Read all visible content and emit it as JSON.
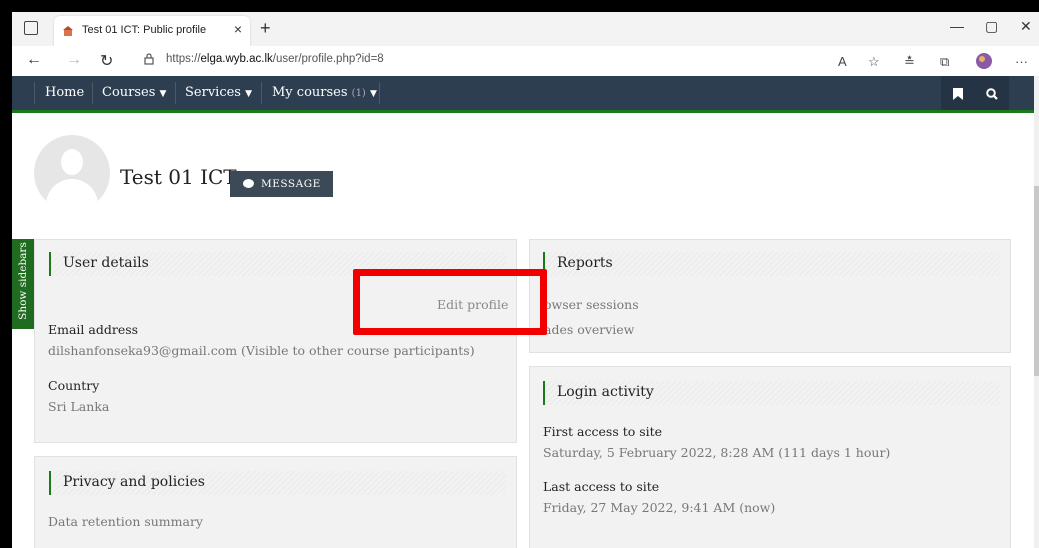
{
  "browser": {
    "tab_title": "Test 01 ICT: Public profile",
    "url_prefix": "https://",
    "url_host": "elga.wyb.ac.lk",
    "url_path": "/user/profile.php?id=8",
    "new_tab": "+",
    "tab_close": "×"
  },
  "navbar": {
    "items": [
      "Home",
      "Courses",
      "Services",
      "My courses"
    ],
    "my_courses_count": "(1)"
  },
  "profile": {
    "name": "Test 01 ICT",
    "message_button": "MESSAGE"
  },
  "sidebars_toggle": "Show sidebars",
  "user_details": {
    "title": "User details",
    "edit_profile": "Edit profile",
    "email_label": "Email address",
    "email_value": "dilshanfonseka93@gmail.com (Visible to other course participants)",
    "country_label": "Country",
    "country_value": "Sri Lanka"
  },
  "reports": {
    "title": "Reports",
    "browser_sessions": "owser sessions",
    "grades_overview": "ades overview"
  },
  "login_activity": {
    "title": "Login activity",
    "first_access_label": "First access to site",
    "first_access_value": "Saturday, 5 February 2022, 8:28 AM  (111 days 1 hour)",
    "last_access_label": "Last access to site",
    "last_access_value": "Friday, 27 May 2022, 9:41 AM  (now)"
  },
  "privacy": {
    "title": "Privacy and policies",
    "data_retention": "Data retention summary"
  },
  "colors": {
    "navbar": "#2c3e50",
    "accent_green": "#1a7a1a",
    "highlight_red": "#f20000"
  }
}
